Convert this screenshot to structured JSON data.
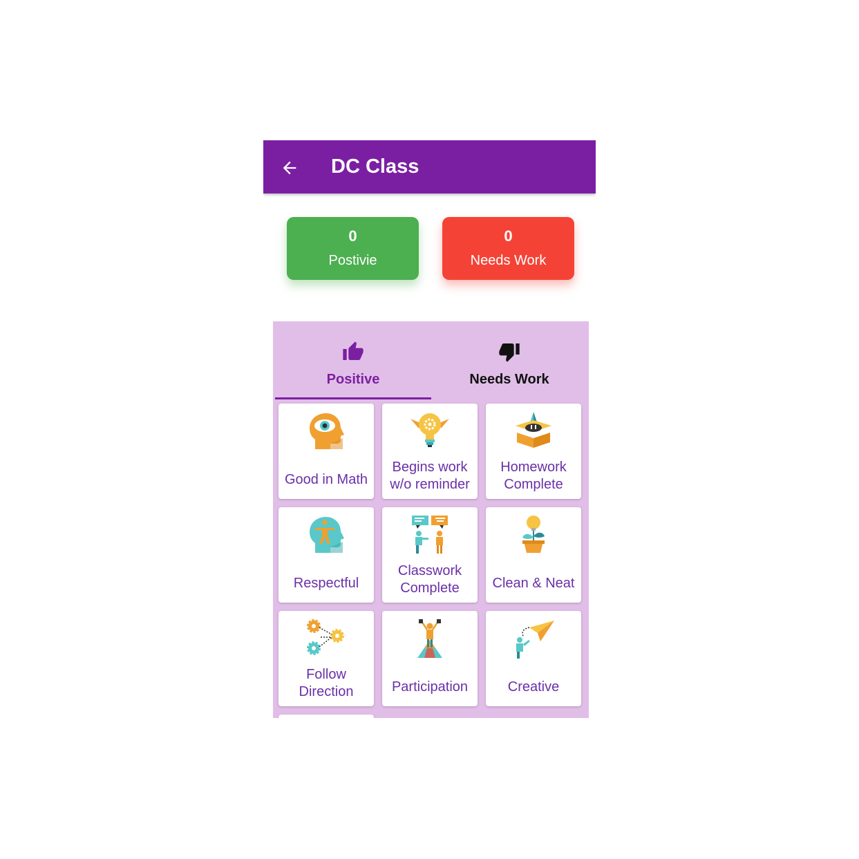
{
  "appbar": {
    "title": "DC Class",
    "back_icon": "arrow-left-icon",
    "color": "#7b1fa2"
  },
  "counters": [
    {
      "value": "0",
      "label": "Postivie",
      "color": "#4caf50"
    },
    {
      "value": "0",
      "label": "Needs Work",
      "color": "#f44336"
    }
  ],
  "tabs": [
    {
      "label": "Positive",
      "icon": "thumbs-up-icon",
      "selected": true
    },
    {
      "label": "Needs Work",
      "icon": "thumbs-down-icon",
      "selected": false
    }
  ],
  "behaviors": [
    {
      "label": "Good in Math",
      "icon": "head-eye-icon"
    },
    {
      "label": "Begins work w/o reminder",
      "icon": "lightbulb-gear-icon"
    },
    {
      "label": "Homework Complete",
      "icon": "open-box-icon"
    },
    {
      "label": "Respectful",
      "icon": "head-person-icon"
    },
    {
      "label": "Classwork Complete",
      "icon": "people-talking-icon"
    },
    {
      "label": "Clean & Neat",
      "icon": "plant-bulb-icon"
    },
    {
      "label": "Follow Direction",
      "icon": "gears-icon"
    },
    {
      "label": "Participation",
      "icon": "person-on-peak-icon"
    },
    {
      "label": "Creative",
      "icon": "paper-plane-icon"
    }
  ],
  "colors": {
    "panel": "#e1bee7",
    "card_text": "#6a2fa8"
  }
}
